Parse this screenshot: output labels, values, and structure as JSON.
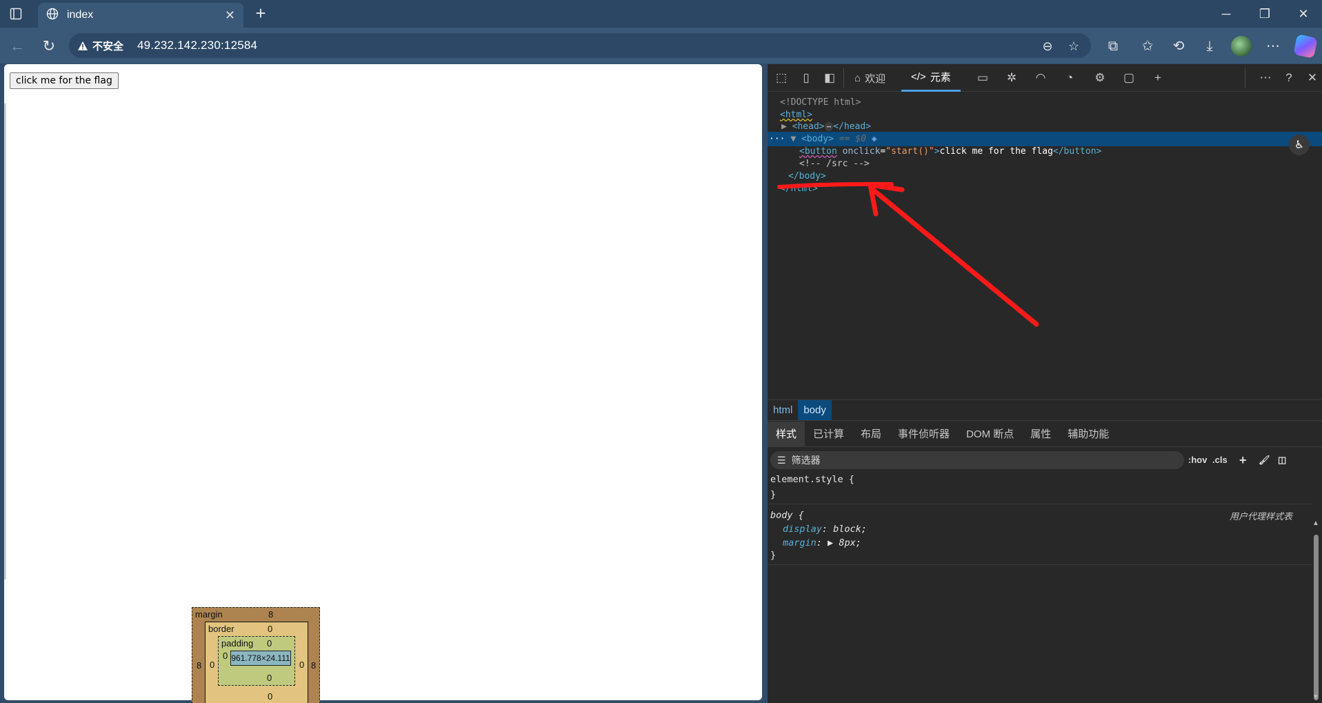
{
  "browser": {
    "tab_title": "index",
    "security_label": "不安全",
    "url": "49.232.142.230:12584"
  },
  "page": {
    "button_label": "click me for the flag"
  },
  "devtools": {
    "tabs": {
      "welcome": "欢迎",
      "elements": "元素"
    },
    "dom": {
      "doctype": "<!DOCTYPE html>",
      "html_open": "<html>",
      "head_open": "<head>",
      "head_close": "</head>",
      "body_open": "<body>",
      "body_ref": "== $0",
      "button_open": "<button",
      "button_attr": "onclick",
      "button_attr_value": "\"start()\"",
      "button_gt": ">",
      "button_text": "click me for the flag",
      "button_close": "</button>",
      "comment": "<!-- /src -->",
      "body_close": "</body>",
      "html_close": "</html>"
    },
    "breadcrumbs": [
      "html",
      "body"
    ],
    "style_tabs": [
      "样式",
      "已计算",
      "布局",
      "事件侦听器",
      "DOM 断点",
      "属性",
      "辅助功能"
    ],
    "filter_placeholder": "筛选器",
    "filter_tools": {
      "hov": ":hov",
      "cls": ".cls"
    },
    "styles": {
      "element_style_selector": "element.style {",
      "close_brace": "}",
      "body_selector": "body {",
      "ua_label": "用户代理样式表",
      "props": [
        {
          "name": "display",
          "value": "block;"
        },
        {
          "name": "margin",
          "value": "8px;"
        }
      ]
    },
    "box_model": {
      "margin_label": "margin",
      "margin_top": "8",
      "margin_left": "8",
      "margin_right": "8",
      "border_label": "border",
      "border_top": "0",
      "border_left": "0",
      "border_right": "0",
      "padding_label": "padding",
      "padding_top": "0",
      "padding_left": "0",
      "padding_right": "0",
      "padding_bottom": "0",
      "border_bottom": "0",
      "content_size": "961.778×24.111"
    }
  },
  "colors": {
    "annotation": "#ff1a1a",
    "selection": "#0b4a7c"
  }
}
